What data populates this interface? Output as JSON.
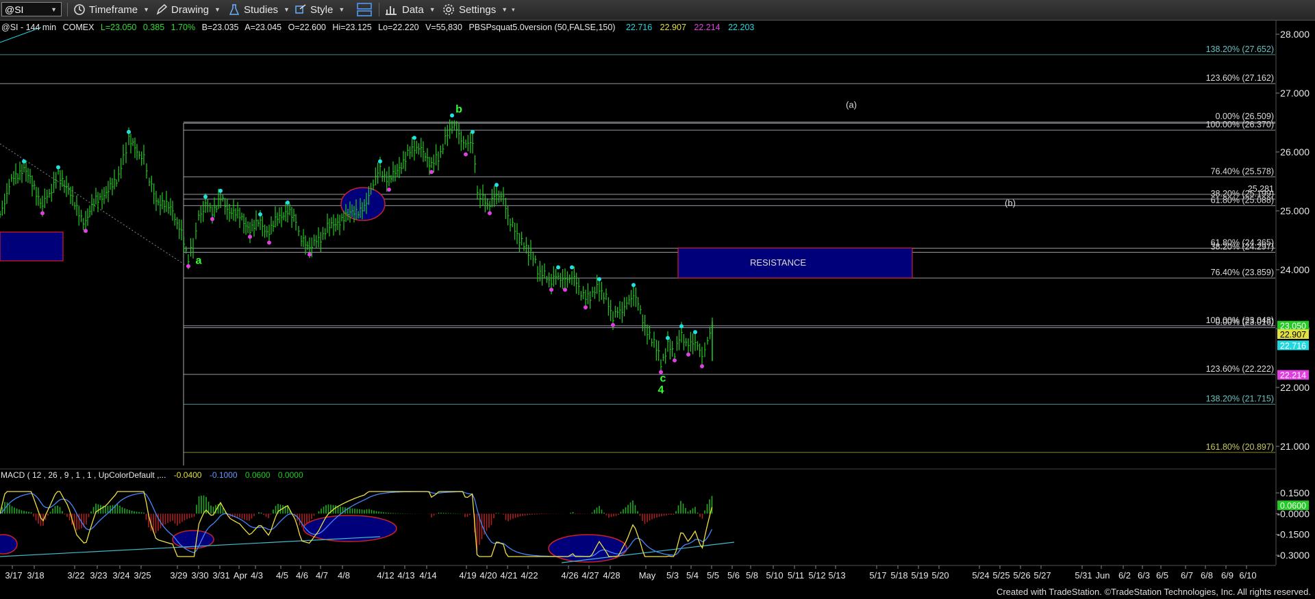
{
  "toolbar": {
    "symbol": "@SI",
    "timeframe": "Timeframe",
    "drawing": "Drawing",
    "studies": "Studies",
    "style": "Style",
    "data": "Data",
    "settings": "Settings"
  },
  "legend": {
    "symbol": "@SI - 144 min",
    "exchange": "COMEX",
    "last": "L=23.050",
    "change": "0.385",
    "pct": "1.70%",
    "bid": "B=23.035",
    "ask": "A=23.045",
    "open": "O=22.600",
    "high": "Hi=23.125",
    "low": "Lo=22.220",
    "volume": "V=55,830",
    "study": "PBSPsquat5.0version (50,FALSE,150)",
    "study_values": [
      "22.716",
      "22.907",
      "22.214",
      "22.203"
    ]
  },
  "macd_legend": {
    "name": "MACD ( 12 , 26 , 9 , 1 , 1 , UpColorDefault ,...",
    "values": [
      "-0.0400",
      "-0.1000",
      "0.0600",
      "0.0000"
    ]
  },
  "footer": "Created with TradeStation. ©TradeStation Technologies, Inc. All rights reserved.",
  "colors": {
    "bar_up": "#22cc22",
    "swing_high": "#22e0e0",
    "swing_low": "#e040e0",
    "resistance_fill": "#00007a",
    "resistance_border": "#ff2222",
    "wave_label": "#33ff33",
    "macd_line": "#f0e040",
    "signal_line": "#4488ff",
    "hist_up": "#22aa22",
    "hist_down": "#aa2222"
  },
  "chart_data": {
    "type": "candlestick",
    "symbol": "@SI",
    "interval": "144 min",
    "price_axis": {
      "range": [
        20.8,
        28.15
      ],
      "ticks": [
        "28.000",
        "27.000",
        "26.000",
        "25.000",
        "24.000",
        "23.000",
        "22.000",
        "21.000"
      ]
    },
    "x_ticks": [
      "3/17",
      "3/18",
      "3/22",
      "3/23",
      "3/24",
      "3/25",
      "3/29",
      "3/30",
      "3/31",
      "Apr",
      "4/3",
      "4/5",
      "4/6",
      "4/7",
      "4/8",
      "4/12",
      "4/13",
      "4/14",
      "4/19",
      "4/20",
      "4/21",
      "4/22",
      "4/26",
      "4/27",
      "4/28",
      "May",
      "5/3",
      "5/4",
      "5/5",
      "5/6",
      "5/8",
      "5/10",
      "5/11",
      "5/12",
      "5/13",
      "5/17",
      "5/18",
      "5/19",
      "5/20",
      "5/24",
      "5/25",
      "5/26",
      "5/27",
      "5/31",
      "Jun",
      "6/2",
      "6/3",
      "6/5",
      "6/7",
      "6/8",
      "6/9",
      "6/10"
    ],
    "price_path": [
      [
        0,
        24.9
      ],
      [
        10,
        25.3
      ],
      [
        20,
        25.6
      ],
      [
        35,
        25.7
      ],
      [
        50,
        25.4
      ],
      [
        62,
        25.1
      ],
      [
        72,
        25.3
      ],
      [
        85,
        25.6
      ],
      [
        100,
        25.4
      ],
      [
        112,
        25.0
      ],
      [
        125,
        24.8
      ],
      [
        140,
        25.2
      ],
      [
        155,
        25.3
      ],
      [
        170,
        25.5
      ],
      [
        180,
        25.9
      ],
      [
        188,
        26.2
      ],
      [
        200,
        26.0
      ],
      [
        210,
        25.9
      ],
      [
        218,
        25.5
      ],
      [
        228,
        25.2
      ],
      [
        240,
        25.1
      ],
      [
        252,
        25.0
      ],
      [
        265,
        24.6
      ],
      [
        275,
        24.2
      ],
      [
        282,
        24.4
      ],
      [
        290,
        24.9
      ],
      [
        300,
        25.1
      ],
      [
        310,
        25.0
      ],
      [
        322,
        25.2
      ],
      [
        335,
        25.0
      ],
      [
        350,
        24.9
      ],
      [
        365,
        24.7
      ],
      [
        380,
        24.8
      ],
      [
        393,
        24.6
      ],
      [
        405,
        24.9
      ],
      [
        420,
        25.0
      ],
      [
        432,
        24.8
      ],
      [
        440,
        24.5
      ],
      [
        452,
        24.4
      ],
      [
        465,
        24.5
      ],
      [
        478,
        24.7
      ],
      [
        490,
        24.8
      ],
      [
        505,
        24.9
      ],
      [
        520,
        25.0
      ],
      [
        535,
        25.1
      ],
      [
        545,
        25.5
      ],
      [
        555,
        25.7
      ],
      [
        568,
        25.5
      ],
      [
        580,
        25.7
      ],
      [
        592,
        25.9
      ],
      [
        605,
        26.1
      ],
      [
        618,
        26.0
      ],
      [
        630,
        25.8
      ],
      [
        640,
        25.9
      ],
      [
        650,
        26.2
      ],
      [
        660,
        26.48
      ],
      [
        670,
        26.3
      ],
      [
        680,
        26.1
      ],
      [
        690,
        26.2
      ],
      [
        697,
        25.3
      ],
      [
        705,
        25.2
      ],
      [
        715,
        25.1
      ],
      [
        725,
        25.3
      ],
      [
        735,
        25.2
      ],
      [
        745,
        24.8
      ],
      [
        755,
        24.6
      ],
      [
        765,
        24.4
      ],
      [
        775,
        24.3
      ],
      [
        785,
        24.0
      ],
      [
        795,
        23.9
      ],
      [
        805,
        23.8
      ],
      [
        815,
        23.9
      ],
      [
        825,
        23.8
      ],
      [
        835,
        23.9
      ],
      [
        845,
        23.7
      ],
      [
        855,
        23.5
      ],
      [
        865,
        23.6
      ],
      [
        875,
        23.7
      ],
      [
        885,
        23.5
      ],
      [
        895,
        23.2
      ],
      [
        905,
        23.3
      ],
      [
        915,
        23.4
      ],
      [
        925,
        23.6
      ],
      [
        935,
        23.3
      ],
      [
        945,
        22.9
      ],
      [
        955,
        22.8
      ],
      [
        965,
        22.4
      ],
      [
        975,
        22.7
      ],
      [
        985,
        22.6
      ],
      [
        995,
        22.9
      ],
      [
        1005,
        22.7
      ],
      [
        1015,
        22.8
      ],
      [
        1025,
        22.5
      ],
      [
        1033,
        22.8
      ],
      [
        1040,
        23.05
      ]
    ],
    "fib_levels": [
      {
        "label": "138.20% (27.652)",
        "price": 27.652
      },
      {
        "label": "123.60% (27.162)",
        "price": 27.162
      },
      {
        "label": "0.00% (26.509)",
        "price": 26.509
      },
      {
        "label": "100.00% (26.370)",
        "price": 26.37
      },
      {
        "label": "76.40% (25.578)",
        "price": 25.578
      },
      {
        "label": "25.281",
        "price": 25.281
      },
      {
        "label": "38.20% (25.199)",
        "price": 25.199
      },
      {
        "label": "61.80% (25.088)",
        "price": 25.088
      },
      {
        "label": "61.80% (24.365)",
        "price": 24.365
      },
      {
        "label": "38.20% (24.297)",
        "price": 24.297
      },
      {
        "label": "76.40% (23.859)",
        "price": 23.859
      },
      {
        "label": "100.00% (23.048)",
        "price": 23.048
      },
      {
        "label": "0.00% (23.016)",
        "price": 23.016
      },
      {
        "label": "123.60% (22.222)",
        "price": 22.222
      },
      {
        "label": "138.20% (21.715)",
        "price": 21.715
      },
      {
        "label": "161.80% (20.897)",
        "price": 20.897
      }
    ],
    "resistance": {
      "label": "RESISTANCE",
      "top": 24.37,
      "bottom": 23.86
    },
    "wave_labels": [
      {
        "text": "a",
        "x": 290,
        "price": 24.1
      },
      {
        "text": "b",
        "x": 670,
        "price": 26.67
      },
      {
        "text": "c",
        "x": 968,
        "price": 22.1
      },
      {
        "text": "4",
        "x": 965,
        "price": 21.9
      },
      {
        "text": "(a)",
        "x": 1243,
        "price": 26.75
      },
      {
        "text": "(b)",
        "x": 1475,
        "price": 25.08
      }
    ],
    "price_badges": [
      {
        "text": "23.050",
        "price": 23.05,
        "color": "#22cc22"
      },
      {
        "text": "22.907",
        "price": 22.907,
        "color": "#e0e040"
      },
      {
        "text": "22.716",
        "price": 22.716,
        "color": "#22d8e0"
      },
      {
        "text": "22.214",
        "price": 22.214,
        "color": "#e040e0"
      }
    ],
    "macd_axis": {
      "range": [
        -0.34,
        0.19
      ],
      "ticks": [
        "0.1500",
        "-0.0000",
        "-0.1500",
        "-0.3000"
      ],
      "badge": "0.0600"
    }
  }
}
